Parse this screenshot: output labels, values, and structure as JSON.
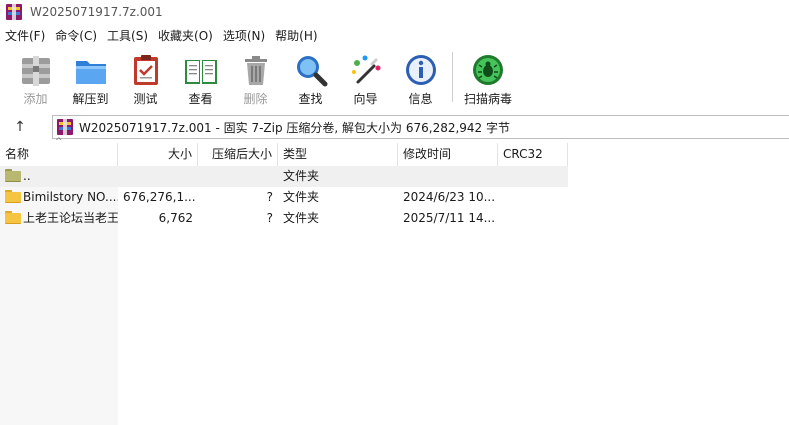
{
  "window": {
    "title": "W2025071917.7z.001"
  },
  "menu": [
    "文件(F)",
    "命令(C)",
    "工具(S)",
    "收藏夹(O)",
    "选项(N)",
    "帮助(H)"
  ],
  "toolbar": {
    "add": "添加",
    "extract": "解压到",
    "test": "测试",
    "view": "查看",
    "delete": "删除",
    "find": "查找",
    "wizard": "向导",
    "info": "信息",
    "scan": "扫描病毒"
  },
  "address": {
    "up": "↑",
    "text": "W2025071917.7z.001 - 固实 7-Zip 压缩分卷, 解包大小为 676,282,942 字节"
  },
  "columns": {
    "name": "名称",
    "size": "大小",
    "packed": "压缩后大小",
    "type": "类型",
    "modified": "修改时间",
    "crc": "CRC32"
  },
  "rows": [
    {
      "name": "..",
      "size": "",
      "packed": "",
      "type": "文件夹",
      "modified": "",
      "crc": ""
    },
    {
      "name": "Bimilstory NO....",
      "size": "676,276,1...",
      "packed": "?",
      "type": "文件夹",
      "modified": "2024/6/23 10...",
      "crc": ""
    },
    {
      "name": "上老王论坛当老王",
      "size": "6,762",
      "packed": "?",
      "type": "文件夹",
      "modified": "2025/7/11 14...",
      "crc": ""
    }
  ]
}
